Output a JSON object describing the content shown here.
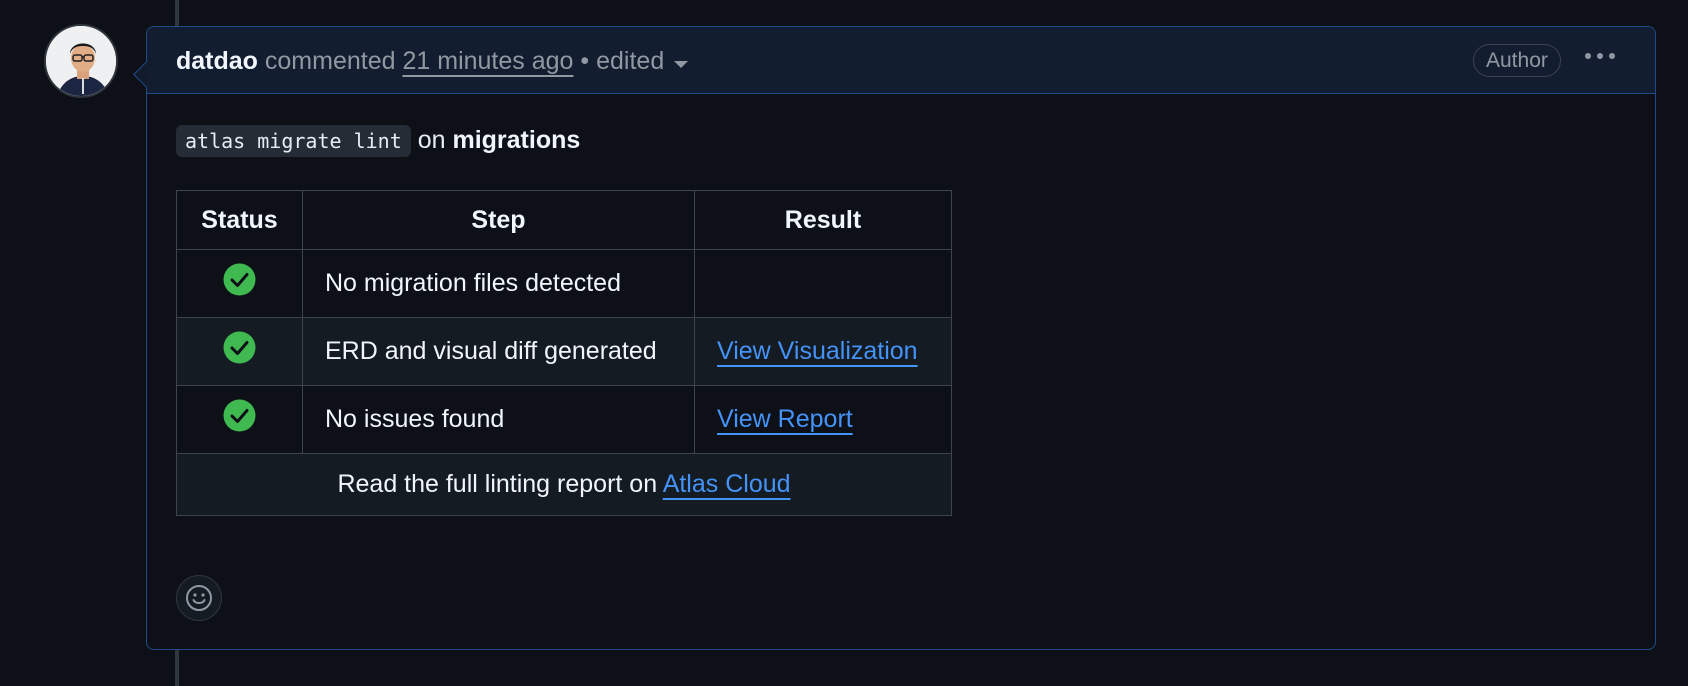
{
  "comment": {
    "author": "datdao",
    "action": "commented",
    "timestamp": "21 minutes ago",
    "separator": "•",
    "edited_label": "edited",
    "author_badge": "Author",
    "avatar_icon": "user-avatar"
  },
  "body": {
    "command": "atlas migrate lint",
    "on_word": "on",
    "target": "migrations"
  },
  "table": {
    "headers": {
      "status": "Status",
      "step": "Step",
      "result": "Result"
    },
    "rows": [
      {
        "status_icon": "check-circle-icon",
        "step": "No migration files detected",
        "result": ""
      },
      {
        "status_icon": "check-circle-icon",
        "step": "ERD and visual diff generated",
        "result": "View Visualization"
      },
      {
        "status_icon": "check-circle-icon",
        "step": "No issues found",
        "result": "View Report"
      }
    ],
    "footer_text": "Read the full linting report on",
    "footer_link": "Atlas Cloud"
  },
  "colors": {
    "background": "#0d1117",
    "header_background": "#121d2f",
    "border_accent": "#1f4b8a",
    "link": "#4493f8",
    "success": "#3fb950"
  }
}
